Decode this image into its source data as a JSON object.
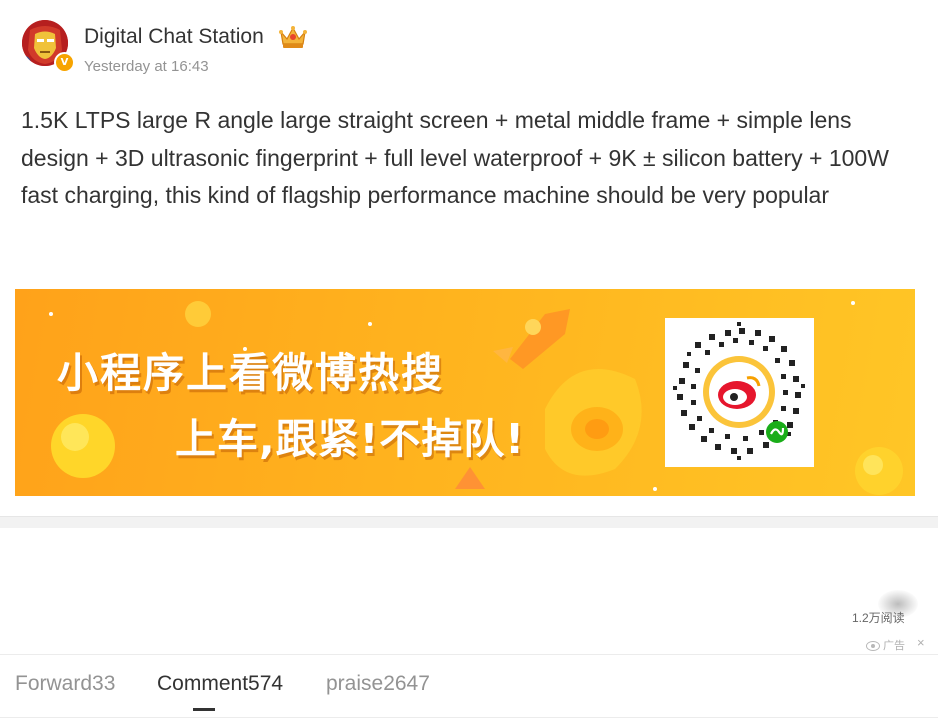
{
  "post": {
    "author": "Digital Chat Station",
    "author_badge": "V",
    "timestamp": "Yesterday at 16:43",
    "text": "1.5K LTPS large R angle large straight screen + metal middle frame + simple lens design + 3D ultrasonic fingerprint + full level waterproof + 9K ± silicon battery + 100W fast charging, this kind of flagship performance machine should be very popular"
  },
  "ad": {
    "title": "小程序上看微博热搜",
    "subtitle": "上车,跟紧!不掉队!",
    "tag": "广告",
    "close": "×",
    "read_count": "1.2万阅读"
  },
  "actions": {
    "forward": "Forward33",
    "comment": "Comment574",
    "praise": "praise2647"
  },
  "colors": {
    "accent_orange": "#ffa21a",
    "text_primary": "#333333",
    "text_secondary": "#939393",
    "verified_badge": "#f7a400"
  },
  "icons": {
    "avatar": "iron-man-avatar",
    "crown": "crown-icon",
    "qr": "weibo-mini-program-qr-icon",
    "ad_eye": "eye-icon",
    "close": "close-icon"
  }
}
